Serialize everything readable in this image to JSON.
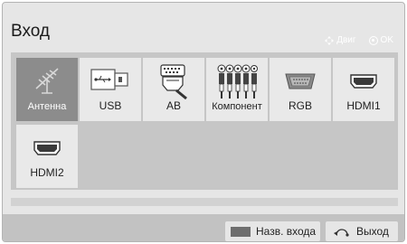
{
  "screen": {
    "title": "Вход",
    "hints": {
      "move": "Двиг",
      "ok": "OK"
    }
  },
  "inputs": [
    {
      "label": "Антенна",
      "icon": "antenna-icon",
      "selected": true
    },
    {
      "label": "USB",
      "icon": "usb-icon",
      "selected": false
    },
    {
      "label": "AB",
      "icon": "scart-icon",
      "selected": false
    },
    {
      "label": "Компонент",
      "icon": "component-rca-icon",
      "selected": false
    },
    {
      "label": "RGB",
      "icon": "vga-icon",
      "selected": false
    },
    {
      "label": "HDMI1",
      "icon": "hdmi-icon",
      "selected": false
    },
    {
      "label": "HDMI2",
      "icon": "hdmi-icon",
      "selected": false
    }
  ],
  "footer": {
    "input_name_label": "Назв. входа",
    "input_name_color": "#6e6e6e",
    "exit_label": "Выход"
  }
}
